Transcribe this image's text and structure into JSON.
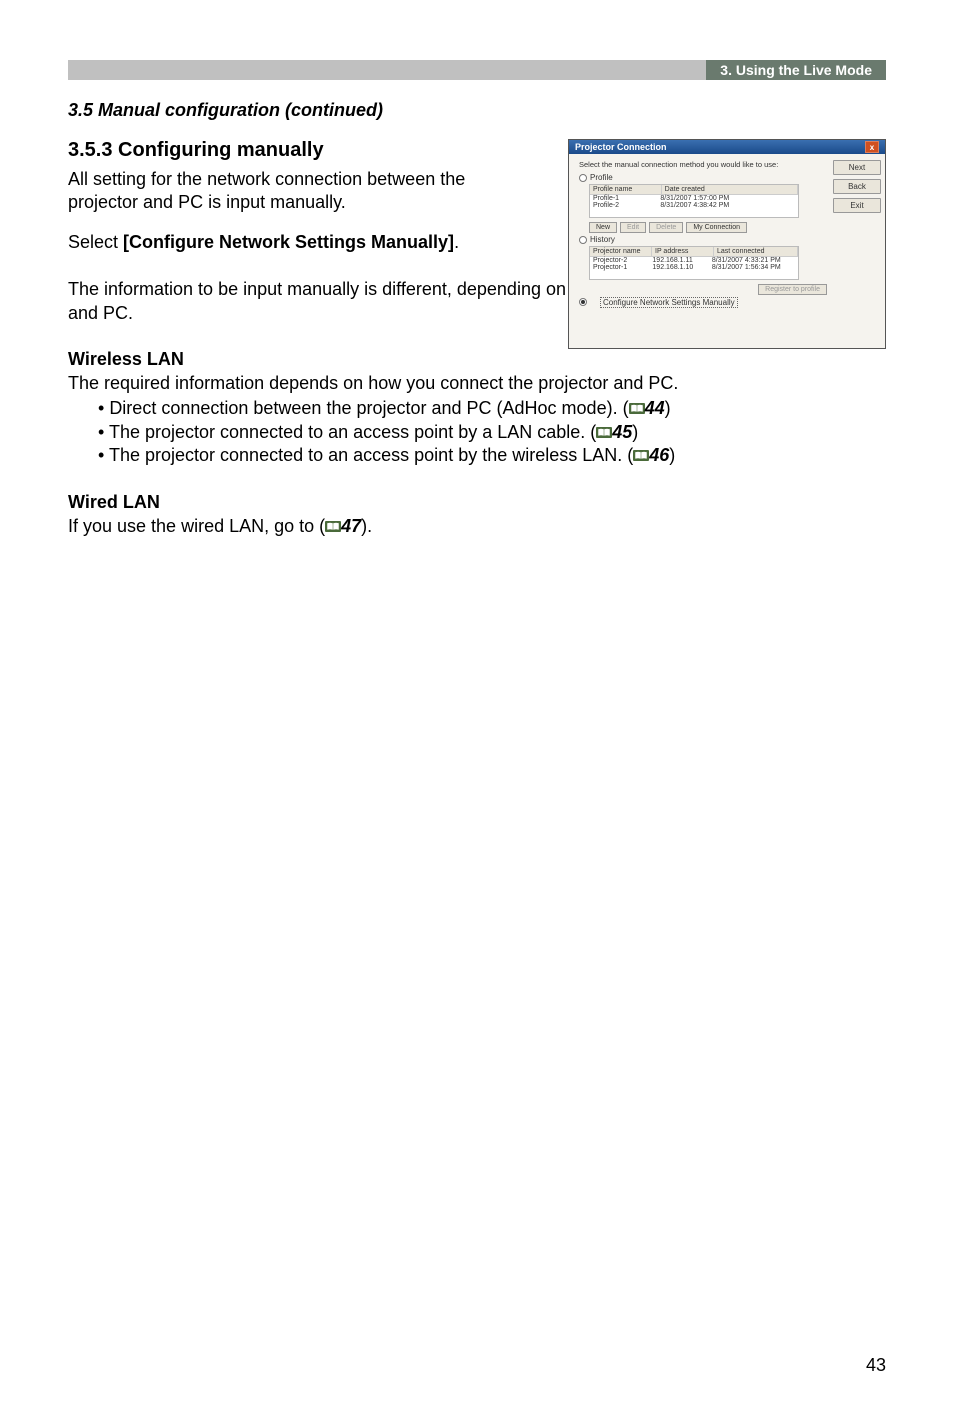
{
  "header": {
    "tab": "3. Using the Live Mode"
  },
  "section_heading": "3.5 Manual configuration (continued)",
  "subsection_heading": "3.5.3 Configuring manually",
  "intro_p1": "All setting for the network connection between the projector and PC is input manually.",
  "intro_p2a": "Select ",
  "intro_p2b": "[Configure Network Settings Manually]",
  "intro_p2c": ".",
  "info_p": "The information to be input manually is different, depending on how you want to connect the projector and PC.",
  "wlan": {
    "heading": "Wireless LAN",
    "body": "The required information depends on how you connect the projector and PC.",
    "bullets": [
      {
        "text": "Direct connection between the projector and PC (AdHoc mode). (",
        "ref": "44",
        "close": ")"
      },
      {
        "text": "The projector connected to an access point by a LAN cable. (",
        "ref": "45",
        "close": ")"
      },
      {
        "text": "The projector connected to an access point by the wireless LAN. (",
        "ref": "46",
        "close": ")"
      }
    ]
  },
  "wired": {
    "heading": "Wired LAN",
    "body_a": "If you use the wired LAN, go to (",
    "ref": "47",
    "body_b": ")."
  },
  "screenshot": {
    "title": "Projector Connection",
    "prompt": "Select the manual connection method you would like to use:",
    "radio_profile": "Profile",
    "radio_history": "History",
    "radio_manual": "Configure Network Settings Manually",
    "profile_table": {
      "h1": "Profile name",
      "h2": "Date created",
      "r1c1": "Profile-1",
      "r1c2": "8/31/2007 1:57:00 PM",
      "r2c1": "Profile-2",
      "r2c2": "8/31/2007 4:38:42 PM"
    },
    "p_btn_new": "New",
    "p_btn_edit": "Edit",
    "p_btn_delete": "Delete",
    "p_btn_myconn": "My Connection",
    "history_table": {
      "h1": "Projector name",
      "h2": "IP address",
      "h3": "Last connected",
      "r1c1": "Projector-2",
      "r1c2": "192.168.1.11",
      "r1c3": "8/31/2007 4:33:21 PM",
      "r2c1": "Projector-1",
      "r2c2": "192.168.1.10",
      "r2c3": "8/31/2007 1:56:34 PM"
    },
    "btn_register": "Register to profile",
    "side_next": "Next",
    "side_back": "Back",
    "side_exit": "Exit"
  },
  "page_number": "43"
}
